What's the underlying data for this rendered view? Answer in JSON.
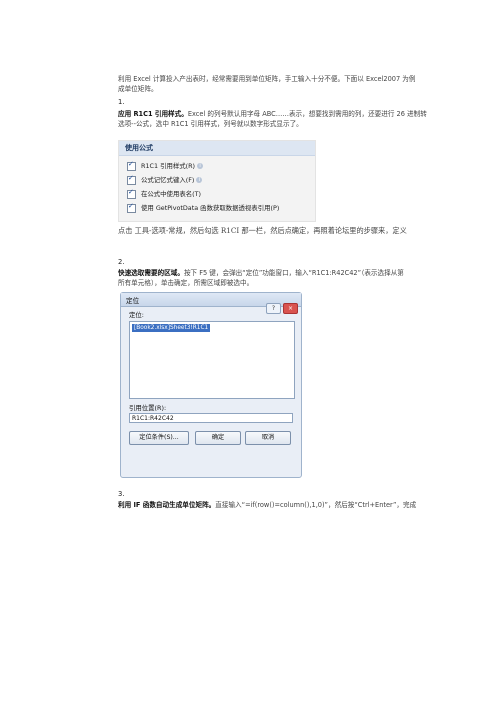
{
  "intro": {
    "line1": "利用 Excel 计算投入产出表时，经常需要用到单位矩阵，手工输入十分不便。下面以 Excel2007 为例",
    "line2": "成单位矩阵。"
  },
  "step1": {
    "num": "1.",
    "heading": "应用 R1C1 引用样式。",
    "line1": "Excel 的列号默认用字母 ABC……表示，想要找到需用的列，还要进行 26 进制转",
    "line2": "选项--公式，选中 R1C1 引用样式，列号就以数字形式显示了。",
    "panel_title": "使用公式",
    "options": [
      "R1C1 引用样式(R)",
      "公式记忆式键入(F)",
      "在公式中使用表名(T)",
      "使用 GetPivotData 函数获取数据透视表引用(P)"
    ],
    "note": "点击 工具-选项-常规，然后勾选 R1CI 那一栏，然后点确定，再照着论坛里的步骤来，定义"
  },
  "step2": {
    "num": "2.",
    "heading": "快速选取需要的区域。",
    "line1": "按下 F5 键，会弹出“定位”功能窗口，输入“R1C1:R42C42”（表示选择从第",
    "line2": "所有单元格），单击确定，所需区域即被选中。",
    "dialog": {
      "title": "定位",
      "goto_label": "定位:",
      "list_item": "[Book2.xlsx]Sheet3!R1C1",
      "ref_label": "引用位置(R):",
      "ref_value": "R1C1:R42C42",
      "special_button": "定位条件(S)...",
      "ok_button": "确定",
      "cancel_button": "取消",
      "help_btn": "?",
      "close_btn": "×"
    }
  },
  "step3": {
    "num": "3.",
    "heading": "利用 IF 函数自动生成单位矩阵。",
    "text": "直接输入“=if(row()=column(),1,0)”，然后按“Ctrl+Enter”，完成"
  }
}
